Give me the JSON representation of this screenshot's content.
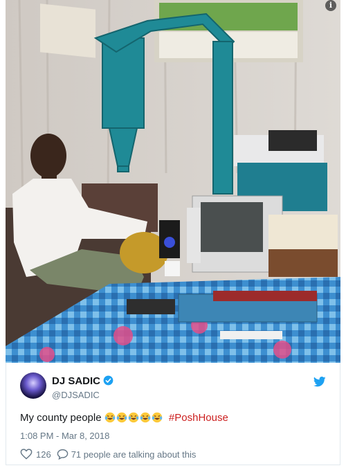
{
  "tweet": {
    "author_name": "DJ SADIC",
    "author_handle": "@DJSADIC",
    "text_before": "My county people",
    "emoji": [
      "laughing-tears",
      "laughing-tears",
      "laughing-tears",
      "laughing-tears",
      "laughing-tears"
    ],
    "hashtag": "#PoshHouse",
    "timestamp": "1:08 PM - Mar 8, 2018",
    "likes_count": "126",
    "replies_text": "71 people are talking about this"
  },
  "colors": {
    "hashtag": "#cc1f1f",
    "twitter_blue": "#1da1f2",
    "meta_gray": "#657786"
  },
  "icons": [
    "info-icon",
    "verified-icon",
    "twitter-bird-icon",
    "heart-icon",
    "reply-icon"
  ]
}
